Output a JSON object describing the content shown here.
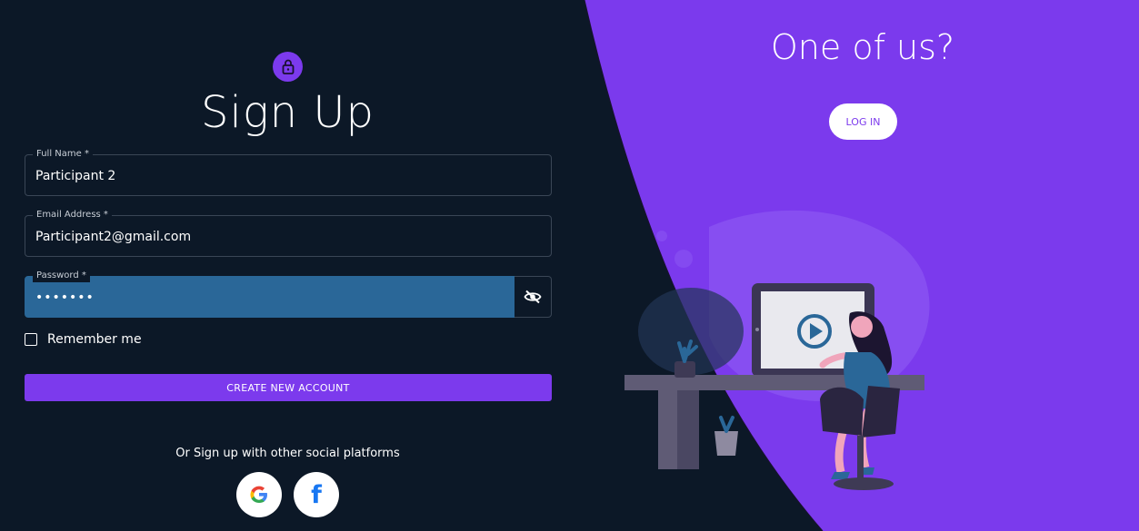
{
  "signup": {
    "title": "Sign Up",
    "full_name_label": "Full Name *",
    "full_name_value": "Participant 2",
    "email_label": "Email Address *",
    "email_value": "Participant2@gmail.com",
    "password_label": "Password *",
    "password_value": "•••••••",
    "remember_label": "Remember me",
    "create_button": "CREATE NEW ACCOUNT",
    "social_text": "Or Sign up with other social platforms",
    "facebook_letter": "f"
  },
  "login_panel": {
    "title": "One of us?",
    "login_button": "LOG IN"
  },
  "colors": {
    "background": "#0c1827",
    "accent": "#7c3aed",
    "password_fill": "#2a6798"
  },
  "icons": [
    "lock-icon",
    "eye-off-icon",
    "google-icon",
    "facebook-icon",
    "play-icon"
  ]
}
